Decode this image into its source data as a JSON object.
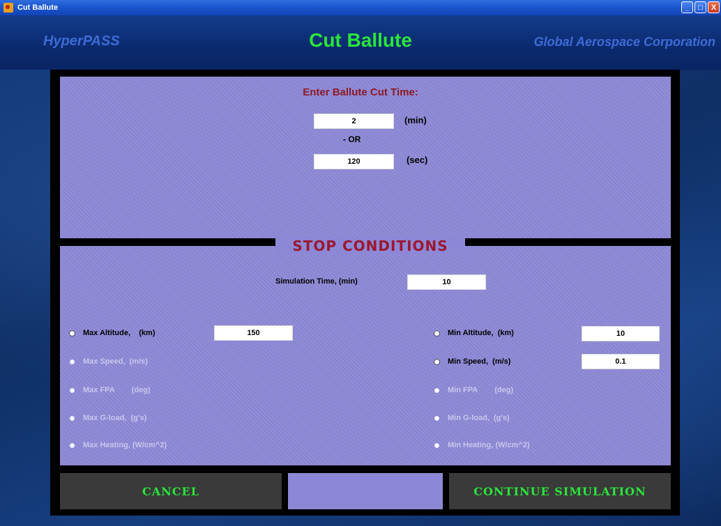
{
  "window": {
    "title": "Cut Ballute",
    "controls": [
      "_",
      "□",
      "X"
    ]
  },
  "header": {
    "left_brand": "HyperPASS",
    "title": "Cut Ballute",
    "right_brand": "Global Aerospace Corporation"
  },
  "cut_time": {
    "label": "Enter Ballute Cut Time:",
    "min_value": "2",
    "min_unit": "(min)",
    "or_label": "- OR",
    "sec_value": "120",
    "sec_unit": "(sec)"
  },
  "stop_conditions": {
    "title": "STOP CONDITIONS",
    "sim_time_label": "Simulation Time,  (min)",
    "sim_time_value": "10",
    "left": [
      {
        "label": "Max Altitude,    (km)",
        "value": "150",
        "active": true
      },
      {
        "label": "Max Speed,  (m/s)",
        "active": false
      },
      {
        "label": "Max FPA        (deg)",
        "active": false
      },
      {
        "label": "Max G-load,  (g's)",
        "active": false
      },
      {
        "label": "Max Heating, (W/cm^2)",
        "active": false
      }
    ],
    "right": [
      {
        "label": "Min Altitude,  (km)",
        "value": "10",
        "active": true
      },
      {
        "label": "Min Speed,  (m/s)",
        "value": "0.1",
        "active": true
      },
      {
        "label": "Min FPA        (deg)",
        "active": false
      },
      {
        "label": "Min G-load,  (g's)",
        "active": false
      },
      {
        "label": "Min Heating, (W/cm^2)",
        "active": false
      }
    ]
  },
  "buttons": {
    "cancel": "CANCEL",
    "continue": "CONTINUE SIMULATION"
  },
  "colors": {
    "panel": "#8d88d6",
    "accent_green": "#29e63a",
    "label_red": "#8b1a28",
    "brand_blue": "#3f6bd6"
  }
}
